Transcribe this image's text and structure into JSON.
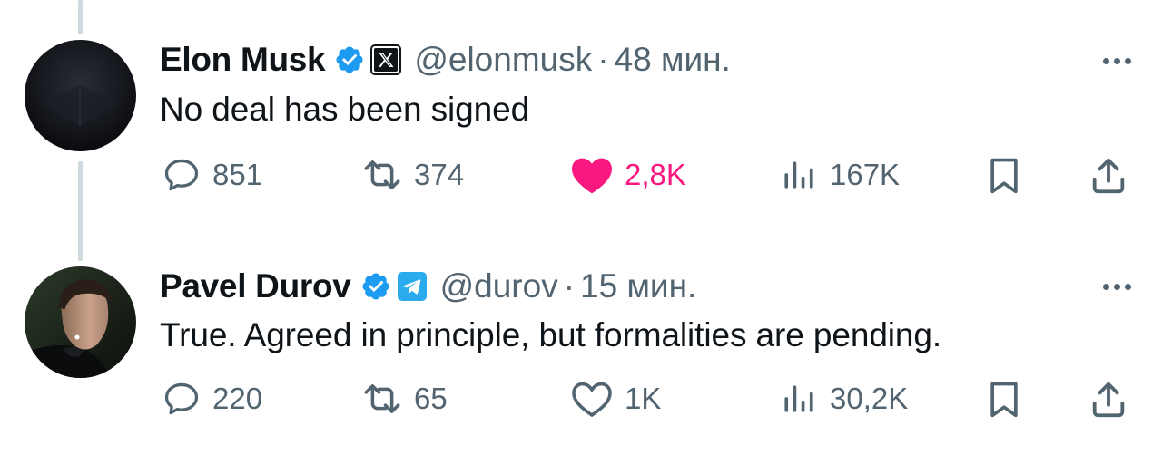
{
  "tweets": [
    {
      "author": "Elon Musk",
      "handle": "@elonmusk",
      "separator": "·",
      "time": "48 мин.",
      "text": "No deal has been signed",
      "affiliation_icon": "x-logo-icon",
      "liked": true,
      "counts": {
        "replies": "851",
        "retweets": "374",
        "likes": "2,8K",
        "views": "167K"
      }
    },
    {
      "author": "Pavel Durov",
      "handle": "@durov",
      "separator": "·",
      "time": "15 мин.",
      "text": "True. Agreed in principle, but formalities are pending.",
      "affiliation_icon": "telegram-logo-icon",
      "liked": false,
      "counts": {
        "replies": "220",
        "retweets": "65",
        "likes": "1K",
        "views": "30,2K"
      }
    }
  ],
  "colors": {
    "text": "#0f1419",
    "secondary": "#536471",
    "verified": "#1d9bf0",
    "like": "#f91880",
    "thread_line": "#cfd9de",
    "telegram": "#2aabee"
  }
}
